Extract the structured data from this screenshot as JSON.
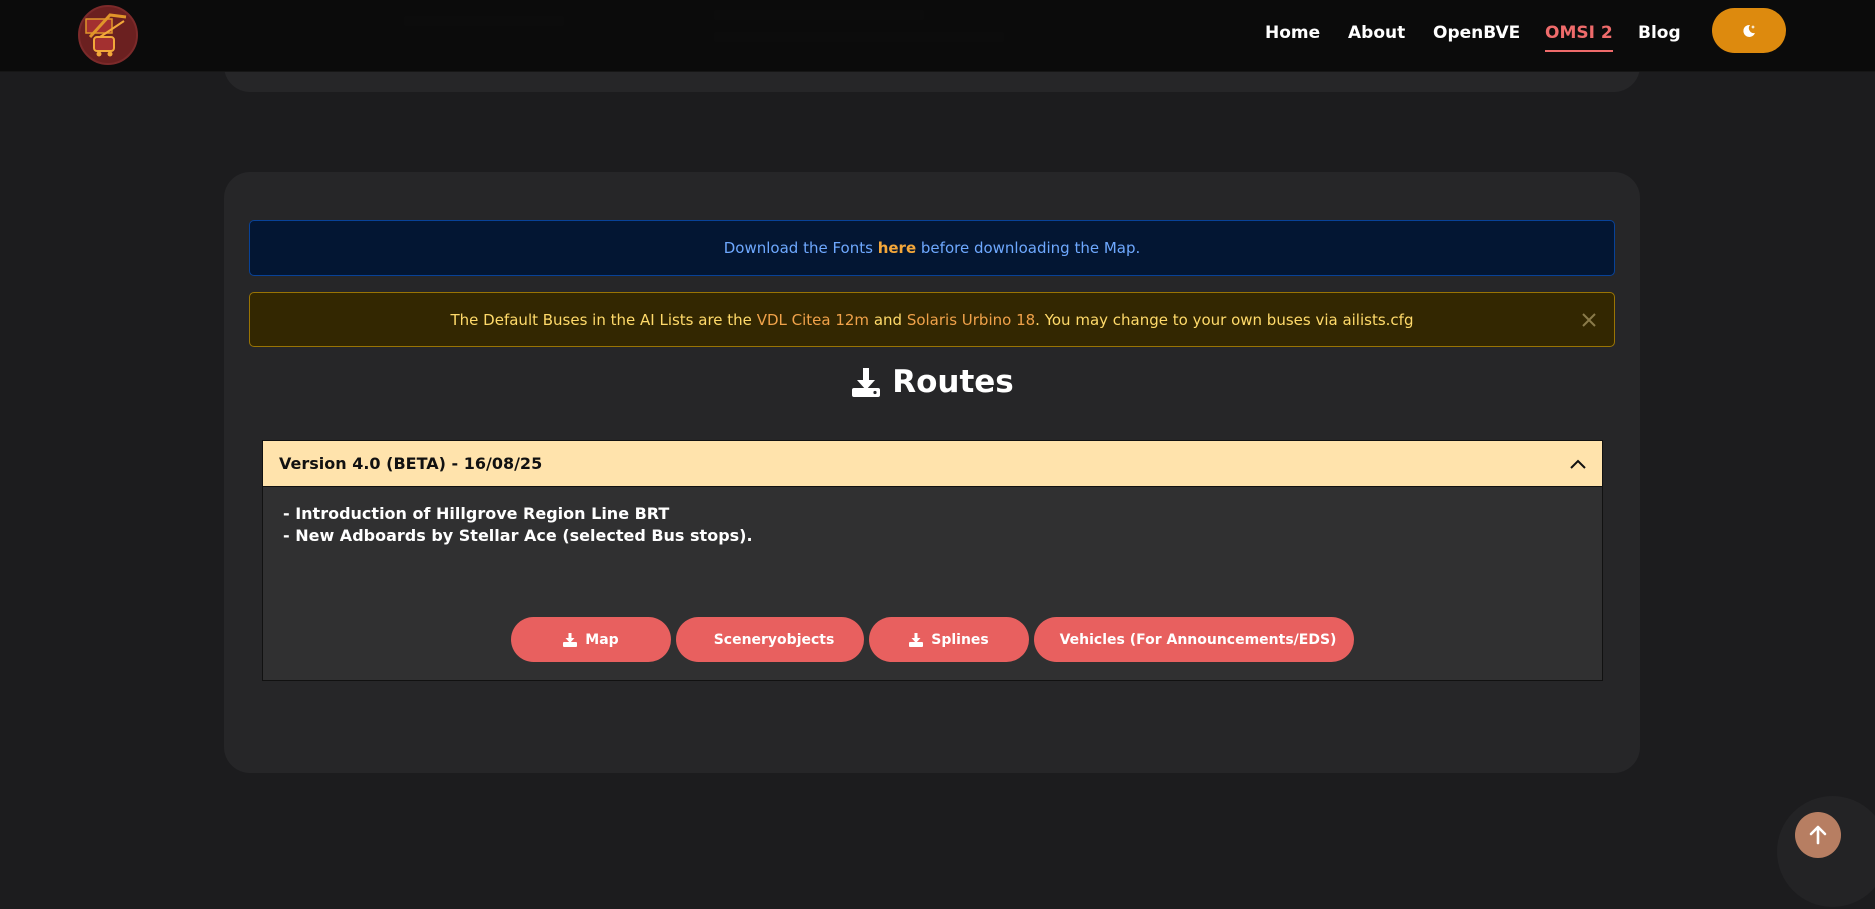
{
  "header": {
    "logo_name": "tram-bus-logo",
    "nav": [
      {
        "label": "Home",
        "active": false
      },
      {
        "label": "About",
        "active": false
      },
      {
        "label": "OpenBVE",
        "active": false
      },
      {
        "label": "OMSI 2",
        "active": true
      },
      {
        "label": "Blog",
        "active": false
      }
    ],
    "theme_icon": "moon-icon"
  },
  "alerts": {
    "info": {
      "prefix": "Download the Fonts ",
      "link": "here",
      "suffix": " before downloading the Map."
    },
    "warning": {
      "prefix": "The Default Buses in the AI Lists are the ",
      "link1": "VDL Citea 12m",
      "mid": " and ",
      "link2": "Solaris Urbino 18",
      "suffix": ". You may change to your own buses via ailists.cfg"
    }
  },
  "routes": {
    "title": "Routes",
    "accordion": {
      "header": "Version 4.0 (BETA) - 16/08/25",
      "expanded": true,
      "items": [
        "- Introduction of Hillgrove Region Line BRT",
        "- New Adboards by Stellar Ace (selected Bus stops)."
      ],
      "buttons": [
        "Map",
        "Sceneryobjects",
        "Splines",
        "Vehicles (For Announcements/EDS)"
      ]
    }
  },
  "colors": {
    "accent": "#ef6b6b",
    "button": "#e8605f",
    "theme_button": "#dd8a0e"
  }
}
